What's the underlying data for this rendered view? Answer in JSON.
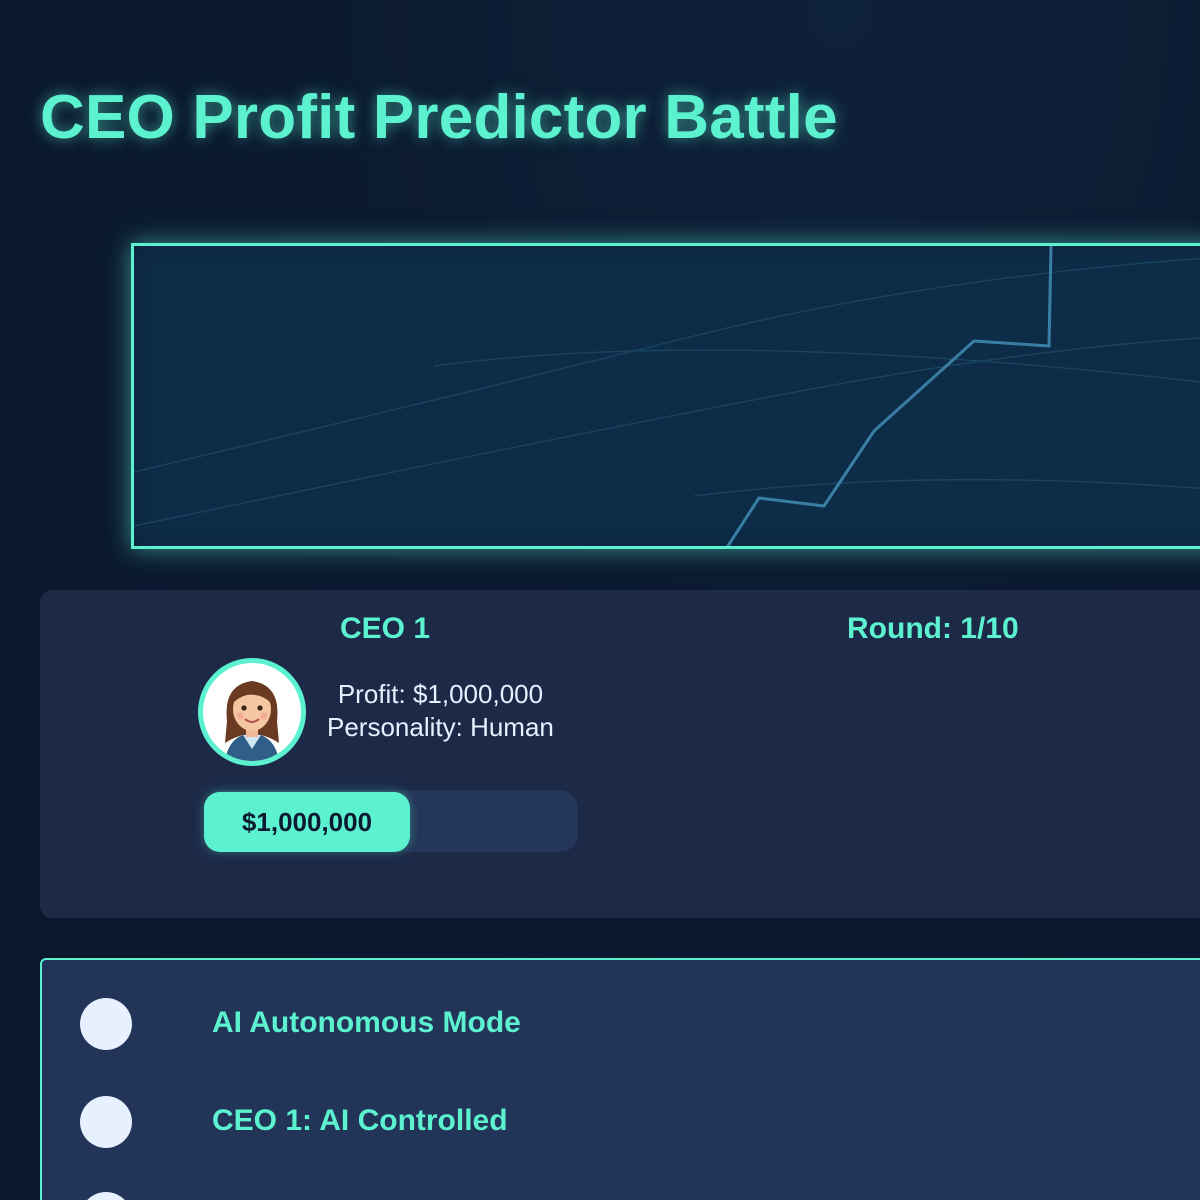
{
  "header": {
    "title": "CEO Profit Predictor Battle"
  },
  "player": {
    "name": "CEO 1",
    "profit_text": "Profit: $1,000,000",
    "personality_text": "Personality: Human",
    "bar_value": "$1,000,000",
    "bar_fraction": 0.55,
    "avatar": "woman-avatar-icon"
  },
  "game": {
    "round_text": "Round: 1/10"
  },
  "controls": {
    "items": [
      {
        "label": "AI Autonomous Mode"
      },
      {
        "label": "CEO 1: AI Controlled"
      },
      {
        "label": ""
      }
    ]
  },
  "colors": {
    "accent": "#5cf2cf",
    "background": "#0b1a30",
    "panel": "#1c2a48",
    "chart_bg": "#0d2c48"
  }
}
